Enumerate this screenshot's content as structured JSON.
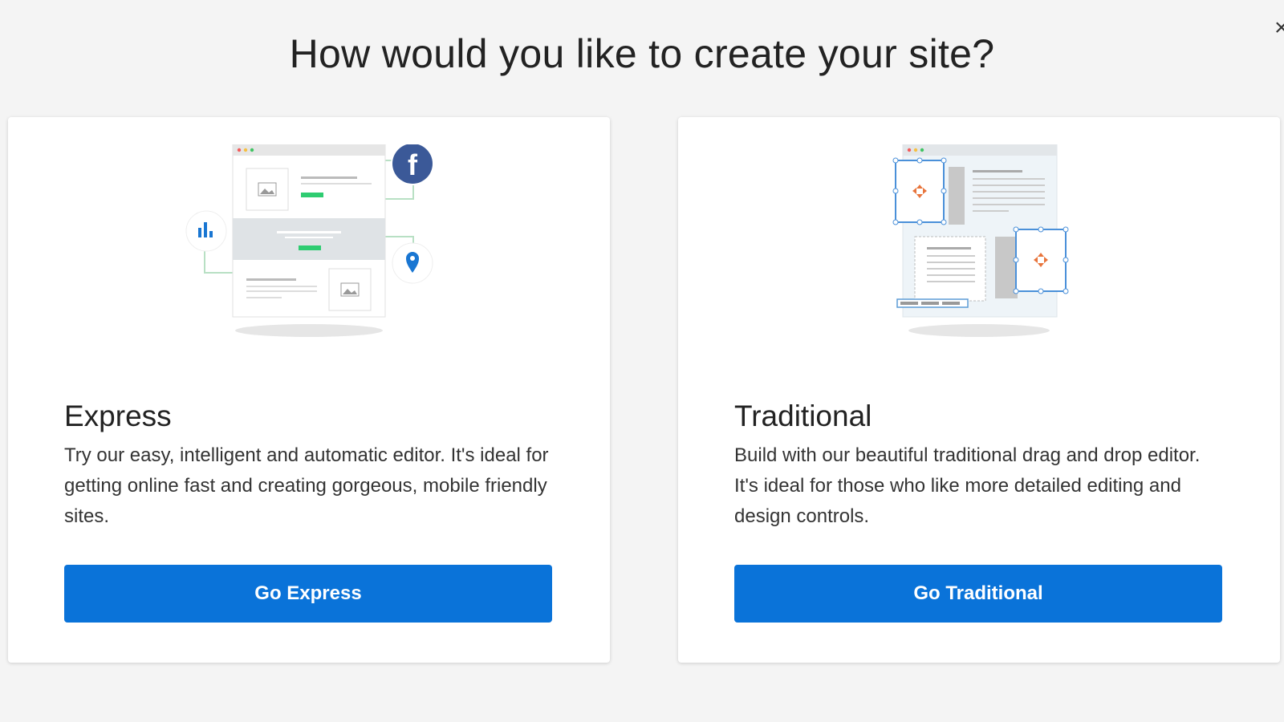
{
  "page": {
    "title": "How would you like to create your site?",
    "close_label": "×"
  },
  "options": [
    {
      "title": "Express",
      "description": "Try our easy, intelligent and automatic editor. It's ideal for getting online fast and creating gorgeous, mobile friendly sites.",
      "button_label": "Go Express",
      "illustration_icons": [
        "browser-mockup-icon",
        "facebook-icon",
        "bar-chart-icon",
        "map-pin-icon"
      ]
    },
    {
      "title": "Traditional",
      "description": "Build with our beautiful traditional drag and drop editor. It's ideal for those who like more detailed editing and design controls.",
      "button_label": "Go Traditional",
      "illustration_icons": [
        "browser-mockup-icon",
        "move-arrows-icon"
      ]
    }
  ],
  "colors": {
    "accent": "#0a73d9",
    "facebook": "#3b5998",
    "green": "#2ecc71",
    "orange": "#e8743b",
    "background": "#f4f4f4"
  }
}
